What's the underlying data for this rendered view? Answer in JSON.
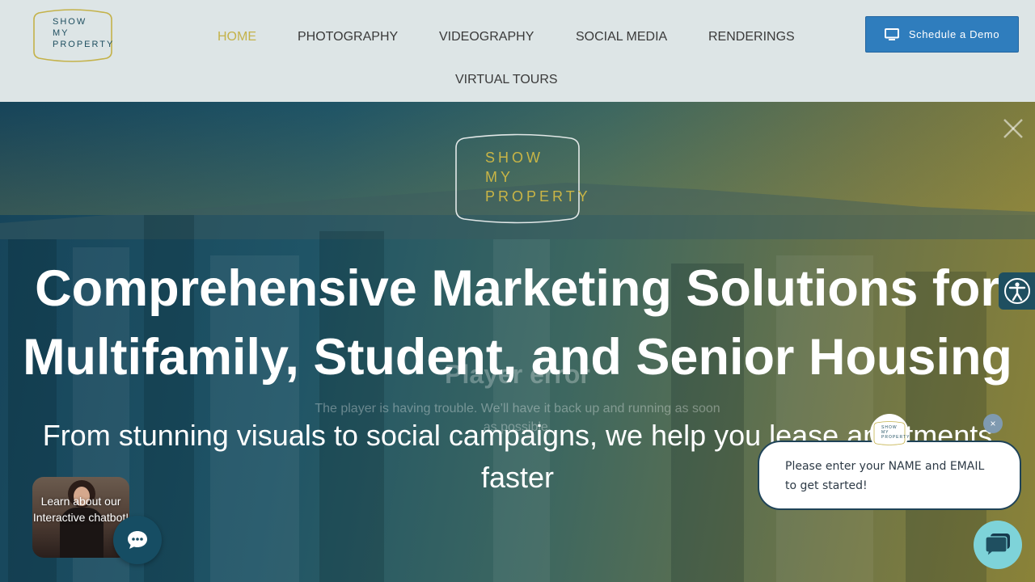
{
  "header": {
    "logo_lines": [
      "SHOW",
      "MY",
      "PROPERTY"
    ],
    "nav": [
      {
        "label": "HOME",
        "active": true
      },
      {
        "label": "PHOTOGRAPHY",
        "active": false
      },
      {
        "label": "VIDEOGRAPHY",
        "active": false
      },
      {
        "label": "SOCIAL MEDIA",
        "active": false
      },
      {
        "label": "RENDERINGS",
        "active": false
      },
      {
        "label": "VIRTUAL TOURS",
        "active": false
      }
    ],
    "demo_button": {
      "label": "Schedule a Demo",
      "icon": "monitor-icon"
    }
  },
  "hero": {
    "logo_lines": [
      "SHOW",
      "MY",
      "PROPERTY"
    ],
    "player_error_title": "Player error",
    "player_error_message": "The player is having trouble. We’ll have it back up and running as soon as possible.",
    "headline_line1": "Comprehensive Marketing Solutions for",
    "headline_line2": "Multifamily, Student, and Senior Housing",
    "subhead_line1": "From stunning visuals to social campaigns, we help you lease apartments",
    "subhead_line2": "faster",
    "close_icon": "close-icon"
  },
  "widgets": {
    "accessibility_icon": "accessibility-icon",
    "video_card_text": "Learn about our Interactive chatbot!",
    "chat_fab_icon": "chat-bubble-icon",
    "bot_avatar_lines": [
      "SHOW",
      "MY",
      "PROPERTY"
    ],
    "bubble_text": "Please enter your NAME and EMAIL to get started!",
    "bubble_close": "×",
    "messenger_icon": "messenger-icon"
  },
  "colors": {
    "header_bg": "#dde5e6",
    "accent_gold": "#c4b24a",
    "demo_button": "#2f7dbd",
    "brand_teal": "#1f4f60",
    "messenger": "#7ed3d9"
  }
}
